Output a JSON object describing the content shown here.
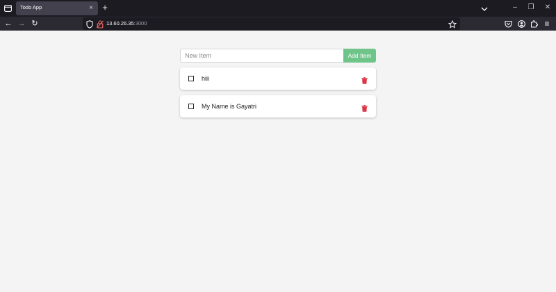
{
  "browser": {
    "tab_title": "Todo App",
    "tab_close": "×",
    "new_tab": "+",
    "url_host": "13.60.26.35",
    "url_port": ":3000",
    "window_minimize": "–",
    "window_restore": "❐",
    "window_close": "✕",
    "nav_back": "←",
    "nav_forward": "→",
    "nav_reload": "↻",
    "toolbar_menu": "≡"
  },
  "form": {
    "input_placeholder": "New Item",
    "input_value": "",
    "add_label": "Add Item"
  },
  "todos": [
    {
      "label": "hiii",
      "checked": false
    },
    {
      "label": "My Name is Gayatri",
      "checked": false
    }
  ],
  "colors": {
    "accent_green": "#6fc48a",
    "trash_red": "#dc3545",
    "page_bg": "#f4f4f4",
    "tabbar_bg": "#1c1b22",
    "navbar_bg": "#2b2a33"
  },
  "icons": {
    "trash": "trash-icon",
    "checkbox": "checkbox-icon"
  }
}
